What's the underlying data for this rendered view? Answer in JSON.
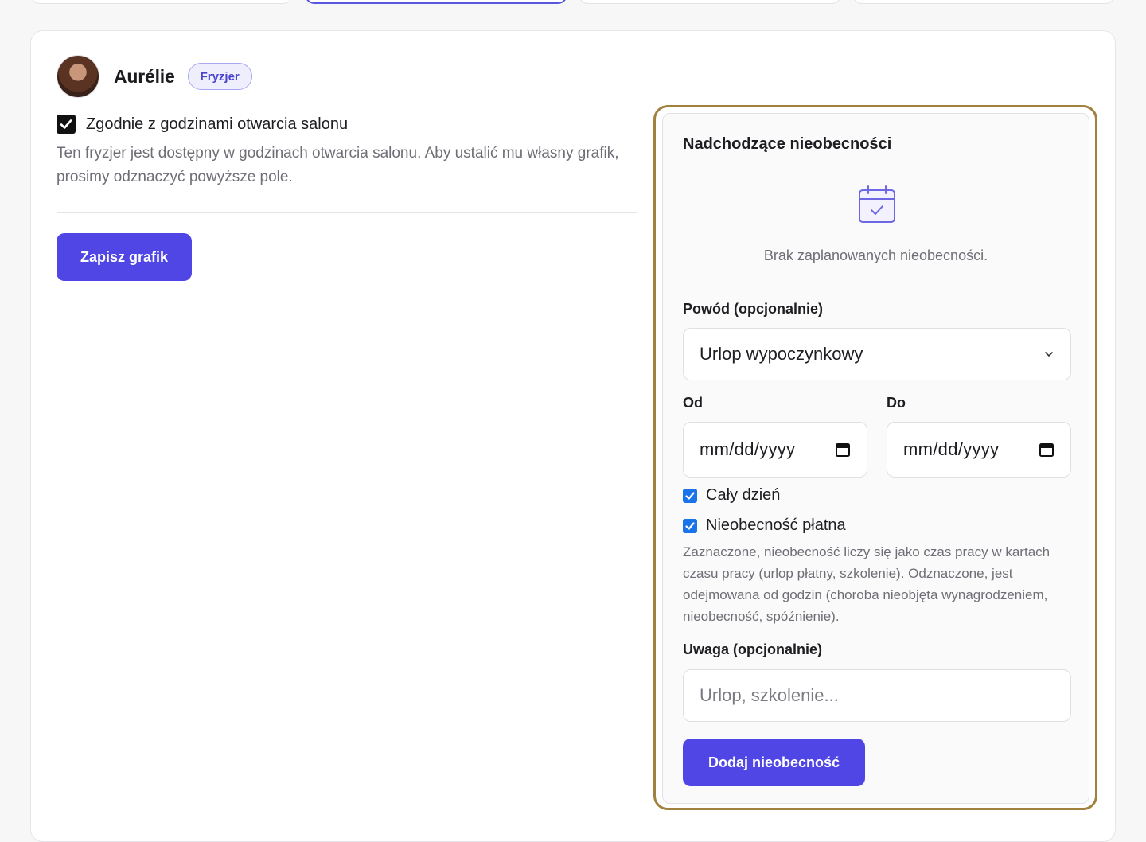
{
  "employee": {
    "name": "Aurélie",
    "role": "Fryzjer"
  },
  "schedule": {
    "salon_hours_label": "Zgodnie z godzinami otwarcia salonu",
    "salon_hours_checked": true,
    "salon_hours_description": "Ten fryzjer jest dostępny w godzinach otwarcia salonu. Aby ustalić mu własny grafik, prosimy odznaczyć powyższe pole.",
    "save_label": "Zapisz grafik"
  },
  "absences": {
    "title": "Nadchodzące nieobecności",
    "empty_icon": "calendar-check-icon",
    "empty_text": "Brak zaplanowanych nieobecności.",
    "reason_label": "Powód (opcjonalnie)",
    "reason_value": "Urlop wypoczynkowy",
    "from_label": "Od",
    "from_value": "mm/dd/yyyy",
    "to_label": "Do",
    "to_value": "mm/dd/yyyy",
    "all_day_label": "Cały dzień",
    "all_day_checked": true,
    "paid_label": "Nieobecność płatna",
    "paid_checked": true,
    "paid_description": "Zaznaczone, nieobecność liczy się jako czas pracy w kartach czasu pracy (urlop płatny, szkolenie). Odznaczone, jest odejmowana od godzin (choroba nieobjęta wynagrodzeniem, nieobecność, spóźnienie).",
    "note_label": "Uwaga (opcjonalnie)",
    "note_placeholder": "Urlop, szkolenie...",
    "add_label": "Dodaj nieobecność"
  },
  "colors": {
    "primary": "#4f46e5",
    "highlight_border": "#a2813f",
    "checkbox_blue": "#1a73e8"
  }
}
